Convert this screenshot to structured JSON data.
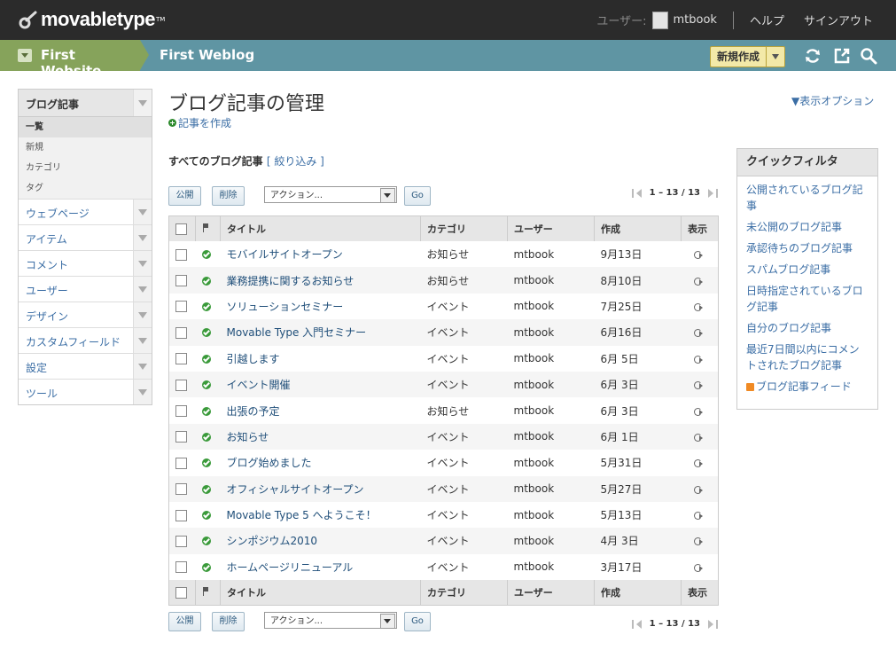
{
  "app": {
    "logo_text": "movabletype",
    "logo_tm": "TM",
    "user_label": "ユーザー:",
    "username": "mtbook",
    "help": "ヘルプ",
    "signout": "サインアウト"
  },
  "nav": {
    "website": "First Website",
    "blog": "First Weblog",
    "create_new": "新規作成"
  },
  "sidebar": {
    "head": "ブログ記事",
    "subitems": [
      "一覧",
      "新規",
      "カテゴリ",
      "タグ"
    ],
    "items": [
      "ウェブページ",
      "アイテム",
      "コメント",
      "ユーザー",
      "デザイン",
      "カスタムフィールド",
      "設定",
      "ツール"
    ]
  },
  "main": {
    "title": "ブログ記事の管理",
    "create_entry": "記事を作成",
    "display_options": "▼表示オプション",
    "list_heading": "すべてのブログ記事",
    "filter": "[ 絞り込み ]"
  },
  "actions": {
    "publish": "公開",
    "delete": "削除",
    "action_select": "アクション...",
    "go": "Go",
    "pager": "1 – 13 / 13"
  },
  "table": {
    "columns": {
      "title": "タイトル",
      "category": "カテゴリ",
      "user": "ユーザー",
      "created": "作成",
      "view": "表示"
    },
    "rows": [
      {
        "title": "モバイルサイトオープン",
        "category": "お知らせ",
        "user": "mtbook",
        "date": "9月13日"
      },
      {
        "title": "業務提携に関するお知らせ",
        "category": "お知らせ",
        "user": "mtbook",
        "date": "8月10日"
      },
      {
        "title": "ソリューションセミナー",
        "category": "イベント",
        "user": "mtbook",
        "date": "7月25日"
      },
      {
        "title": "Movable Type 入門セミナー",
        "category": "イベント",
        "user": "mtbook",
        "date": "6月16日"
      },
      {
        "title": "引越します",
        "category": "イベント",
        "user": "mtbook",
        "date": "6月 5日"
      },
      {
        "title": "イベント開催",
        "category": "イベント",
        "user": "mtbook",
        "date": "6月 3日"
      },
      {
        "title": "出張の予定",
        "category": "お知らせ",
        "user": "mtbook",
        "date": "6月 3日"
      },
      {
        "title": "お知らせ",
        "category": "イベント",
        "user": "mtbook",
        "date": "6月 1日"
      },
      {
        "title": "ブログ始めました",
        "category": "イベント",
        "user": "mtbook",
        "date": "5月31日"
      },
      {
        "title": "オフィシャルサイトオープン",
        "category": "イベント",
        "user": "mtbook",
        "date": "5月27日"
      },
      {
        "title": "Movable Type 5 へようこそ！",
        "category": "イベント",
        "user": "mtbook",
        "date": "5月13日"
      },
      {
        "title": "シンポジウム2010",
        "category": "イベント",
        "user": "mtbook",
        "date": "4月 3日"
      },
      {
        "title": "ホームページリニューアル",
        "category": "イベント",
        "user": "mtbook",
        "date": "3月17日"
      }
    ]
  },
  "quick_filter": {
    "head": "クイックフィルタ",
    "items": [
      "公開されているブログ記事",
      "未公開のブログ記事",
      "承認待ちのブログ記事",
      "スパムブログ記事",
      "日時指定されているブログ記事",
      "自分のブログ記事",
      "最近7日間以内にコメントされたブログ記事"
    ],
    "feed": "ブログ記事フィード"
  },
  "colors": {
    "topbar": "#2b2b2b",
    "navbar": "#5f95a3",
    "website_tab": "#86a35b",
    "link": "#3b6ea5",
    "status_published": "#3a9a3a"
  }
}
